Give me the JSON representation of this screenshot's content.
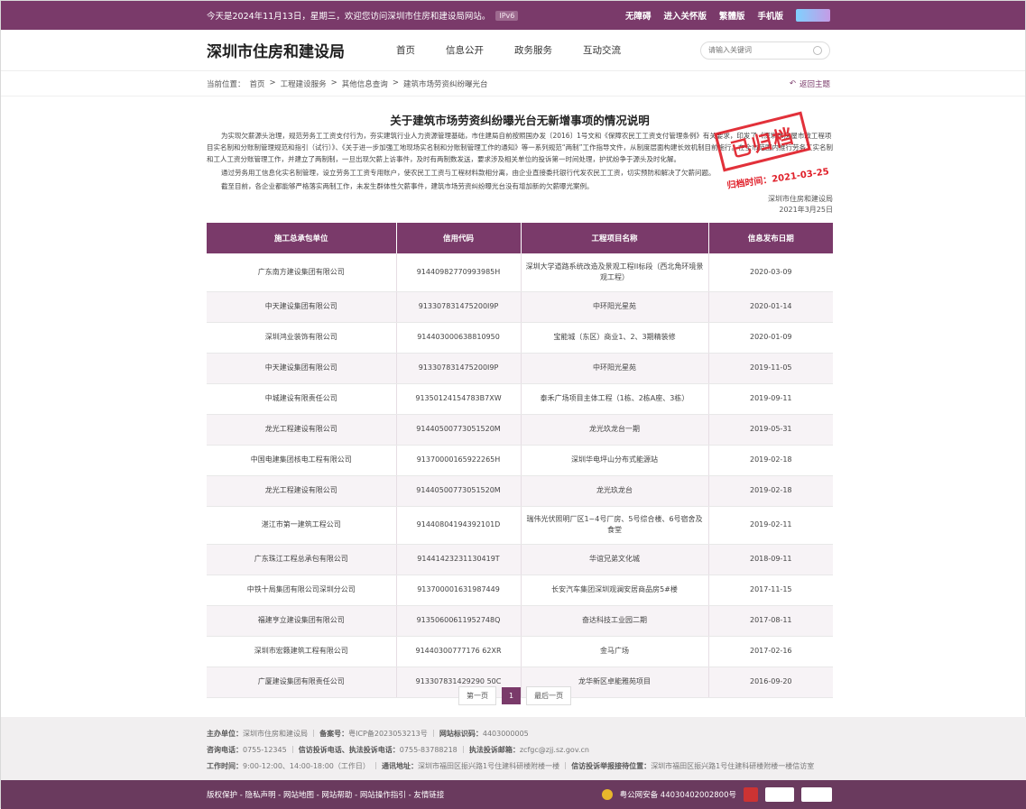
{
  "topbar": {
    "welcome": "今天是2024年11月13日，星期三，欢迎您访问深圳市住房和建设局网站。",
    "ipv6": "IPv6",
    "links": [
      "无障碍",
      "进入关怀版",
      "繁體版",
      "手机版"
    ]
  },
  "header": {
    "site_title": "深圳市住房和建设局",
    "nav": [
      "首页",
      "信息公开",
      "政务服务",
      "互动交流"
    ],
    "search_placeholder": "请输入关键词"
  },
  "breadcrumb": {
    "prefix": "当前位置：",
    "items": [
      "首页",
      "工程建设服务",
      "其他信息查询",
      "建筑市场劳资纠纷曝光台"
    ],
    "sep": ">",
    "back": "返回主题"
  },
  "article": {
    "title": "关于建筑市场劳资纠纷曝光台无新增事项的情况说明",
    "paragraphs": [
      "为实现欠薪源头治理，规范劳务工工资支付行为，夯实建筑行业人力资源管理基础，市住建局自前按照国办发〔2016〕1号文和《保障农民工工资支付管理条例》有关要求，印发了《深圳市房屋市政工程项目实名制和分账制管理规范和指引（试行）》、《关于进一步加强工地现场实名制和分账制管理工作的通知》等一系列规范“两制”工作指导文件，从制度层面构建长效机制目前施行。在全市范围内推行劳务工实名制和工人工资分账管理工作，并建立了两制制，一旦出现欠薪上访事件，及时有两制数发送，要求涉及相关单位的投诉第一时间处理，护扰纷争于源头及时化解。",
      "通过劳务用工信息化实名制管理，设立劳务工工资专用账户，使农民工工资与工程材料款相分离，由企业直接委托银行代发农民工工资，切实预防和解决了欠薪问题。",
      "截至目前，各企业都能够严格落实两制工作，未发生群体性欠薪事件，建筑市场劳资纠纷曝光台没有增加新的欠薪曝光案例。"
    ],
    "signature": "深圳市住房和建设局",
    "date": "2021年3月25日",
    "stamp_text": "已归档",
    "stamp_date": "归档时间：2021-03-25"
  },
  "table": {
    "headers": [
      "施工总承包单位",
      "信用代码",
      "工程项目名称",
      "信息发布日期"
    ],
    "rows": [
      [
        "广东南方建设集团有限公司",
        "91440982770993985H",
        "深圳大学道路系统改造及景观工程II标段（西北角环境景观工程）",
        "2020-03-09"
      ],
      [
        "中天建设集团有限公司",
        "913307831475200I9P",
        "中环阳光星苑",
        "2020-01-14"
      ],
      [
        "深圳鸿业装饰有限公司",
        "914403000638810950",
        "宝能城（东区）商业1、2、3期精装修",
        "2020-01-09"
      ],
      [
        "中天建设集团有限公司",
        "913307831475200I9P",
        "中环阳光星苑",
        "2019-11-05"
      ],
      [
        "中城建设有限责任公司",
        "91350124154783B7XW",
        "泰禾广场项目主体工程（1栋、2栋A座、3栋）",
        "2019-09-11"
      ],
      [
        "龙光工程建设有限公司",
        "91440500773051520M",
        "龙光玖龙台一期",
        "2019-05-31"
      ],
      [
        "中国电建集团核电工程有限公司",
        "91370000165922265H",
        "深圳华电坪山分布式能源站",
        "2019-02-18"
      ],
      [
        "龙光工程建设有限公司",
        "91440500773051520M",
        "龙光玖龙台",
        "2019-02-18"
      ],
      [
        "湛江市第一建筑工程公司",
        "91440804194392101D",
        "瑞伟光伏照明厂区1~4号厂房、5号综合楼、6号宿舍及食堂",
        "2019-02-11"
      ],
      [
        "广东珠江工程总承包有限公司",
        "91441423231130419T",
        "华谊兄弟文化城",
        "2018-09-11"
      ],
      [
        "中铁十局集团有限公司深圳分公司",
        "913700001631987449",
        "长安汽车集团深圳观澜安居商品房5#楼",
        "2017-11-15"
      ],
      [
        "福建亨立建设集团有限公司",
        "91350600611952748Q",
        "奋达科技工业园二期",
        "2017-08-11"
      ],
      [
        "深圳市宏籁建筑工程有限公司",
        "91440300777176 62XR",
        "金马广场",
        "2017-02-16"
      ],
      [
        "广厦建设集团有限责任公司",
        "913307831429290 50C",
        "龙华新区卓能雅苑项目",
        "2016-09-20"
      ]
    ]
  },
  "pager": {
    "first": "第一页",
    "current": "1",
    "last": "最后一页"
  },
  "footer": {
    "line1": [
      {
        "k": "主办单位：",
        "v": "深圳市住房和建设局"
      },
      {
        "k": "备案号：",
        "v": "粤ICP备2023053213号"
      },
      {
        "k": "网站标识码：",
        "v": "4403000005"
      }
    ],
    "line2": [
      {
        "k": "咨询电话：",
        "v": "0755-12345"
      },
      {
        "k": "信访投诉电话、执法投诉电话：",
        "v": "0755-83788218"
      },
      {
        "k": "执法投诉邮箱：",
        "v": "zcfgc@zjj.sz.gov.cn"
      }
    ],
    "line3": [
      {
        "k": "工作时间：",
        "v": "9:00-12:00、14:00-18:00（工作日）"
      },
      {
        "k": "通讯地址：",
        "v": "深圳市福田区振兴路1号住建科研楼附楼一楼"
      },
      {
        "k": "信访投诉举报接待位置：",
        "v": "深圳市福田区振兴路1号住建科研楼附楼一楼信访室"
      }
    ]
  },
  "bottombar": {
    "links": "版权保护 - 隐私声明 - 网站地图 - 网站帮助 - 网站操作指引 - 友情链接",
    "police": "粤公网安备 44030402002800号"
  },
  "colors": {
    "brand": "#7a3a6a",
    "stamp": "#e0202a"
  }
}
